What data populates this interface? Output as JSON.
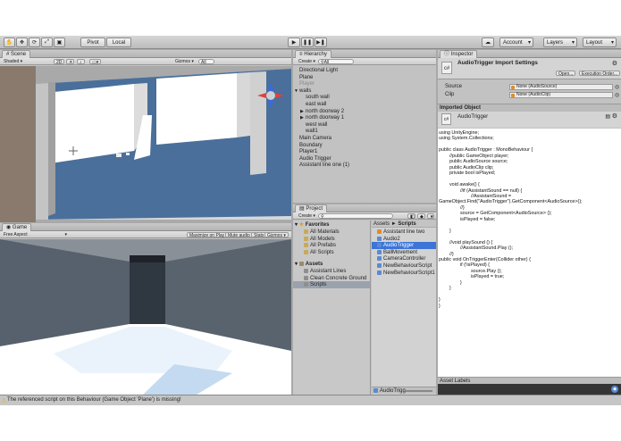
{
  "toolbar": {
    "pivot": "Pivot",
    "local": "Local",
    "account": "Account",
    "layers": "Layers",
    "layout": "Layout"
  },
  "scene": {
    "tab": "Scene",
    "shading": "Shaded",
    "mode2d": "2D",
    "gizmos": "Gizmos",
    "search": "All"
  },
  "game": {
    "tab": "Game",
    "aspect": "Free Aspect",
    "maximize": "Maximize on Play",
    "mute": "Mute audio",
    "stats": "Stats",
    "gizmos": "Gizmos"
  },
  "hierarchy": {
    "tab": "Hierarchy",
    "create": "Create",
    "search": "All",
    "items": [
      {
        "label": "Directional Light",
        "indent": 0
      },
      {
        "label": "Plane",
        "indent": 0
      },
      {
        "label": "Player",
        "indent": 0,
        "muted": true
      },
      {
        "label": "walls",
        "indent": 0,
        "arrow": "down"
      },
      {
        "label": "south wall",
        "indent": 1
      },
      {
        "label": "east wall",
        "indent": 1
      },
      {
        "label": "north doorway 2",
        "indent": 1,
        "arrow": "right"
      },
      {
        "label": "north doorway 1",
        "indent": 1,
        "arrow": "right"
      },
      {
        "label": "west wall",
        "indent": 1
      },
      {
        "label": "wall1",
        "indent": 1
      },
      {
        "label": "Main Camera",
        "indent": 0
      },
      {
        "label": "Boundary",
        "indent": 0
      },
      {
        "label": "Player1",
        "indent": 0
      },
      {
        "label": "Audio Trigger",
        "indent": 0
      },
      {
        "label": "Assistant line one (1)",
        "indent": 0
      }
    ]
  },
  "project": {
    "tab": "Project",
    "create": "Create",
    "favorites_label": "Favorites",
    "favorites": [
      "All Materials",
      "All Models",
      "All Prefabs",
      "All Scripts"
    ],
    "assets_label": "Assets",
    "assets": [
      "Assistant Lines",
      "Clean Concrete Ground",
      "Scripts"
    ],
    "breadcrumb_root": "Assets",
    "breadcrumb_sep": "►",
    "breadcrumb_leaf": "Scripts",
    "files": [
      {
        "label": "Assistant line two",
        "kind": "audio"
      },
      {
        "label": "Audio2",
        "kind": "script"
      },
      {
        "label": "AudioTrigger",
        "kind": "script",
        "selected": true
      },
      {
        "label": "BallMovement",
        "kind": "script"
      },
      {
        "label": "CameraController",
        "kind": "script"
      },
      {
        "label": "NewBehaviourScript",
        "kind": "script"
      },
      {
        "label": "NewBehaviourScript1",
        "kind": "script"
      }
    ],
    "footer_file": "AudioTrigg"
  },
  "inspector": {
    "tab": "Inspector",
    "title": "AudioTrigger Import Settings",
    "open": "Open...",
    "execution_order": "Execution Order...",
    "source_label": "Source",
    "source_value": "None (AudioSource)",
    "clip_label": "Clip",
    "clip_value": "None (AudioClip)",
    "imported_object": "Imported Object",
    "object_name": "AudioTrigger",
    "code": "using UnityEngine;\nusing System.Collections;\n\npublic class AudioTrigger : MonoBehaviour {\n        //public GameObject player;\n        public AudioSource source;\n        public AudioClip clip;\n        private bool isPlayed;\n\n        void awake() {\n                //if (AssistantSound == null) {\n                        //AssistantSound =\nGameObject.Find(\"AudioTrigger\").GetComponent<AudioSource>();\n                //}\n                source = GetComponent<AudioSource> ();\n                isPlayed = false;\n\n        }\n\n        //void playSound () {\n                //AssistantSound.Play ();\n        //}\npublic void OnTriggerEnter(Collider other) {\n                if (!isPlayed) {\n                        source.Play ();\n                        isPlayed = true;\n                }\n        }\n\n}\n}",
    "asset_labels": "Asset Labels"
  },
  "status": {
    "message": "The referenced script on this Behaviour (Game Object 'Plane') is missing!"
  },
  "colors": {
    "selection": "#3c74d8",
    "panel_bg": "#c2c2c2",
    "code_bg": "#ffffff",
    "warning": "#e8b020"
  }
}
